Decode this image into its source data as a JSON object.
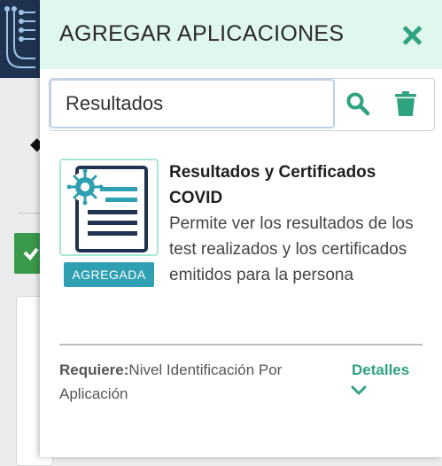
{
  "panel": {
    "title": "AGREGAR APLICACIONES"
  },
  "search": {
    "value": "Resultados"
  },
  "app": {
    "title": "Resultados y Certificados COVID",
    "description": "Permite ver los resultados de los test realizados y los certificados emitidos para la persona",
    "status_badge": "AGREGADA",
    "requires_label": "Requiere:",
    "requires_value": "Nivel Identificación Por Aplicación",
    "details_label": "Detalles"
  },
  "colors": {
    "accent": "#2fa27f",
    "header_bg": "#dff7ec",
    "badge_bg": "#2fa0b1",
    "icon_dark": "#1f3350"
  },
  "icons": {
    "close": "close-icon",
    "search": "search-icon",
    "trash": "trash-icon",
    "chevron": "chevron-down-icon",
    "app": "virus-document-icon"
  }
}
